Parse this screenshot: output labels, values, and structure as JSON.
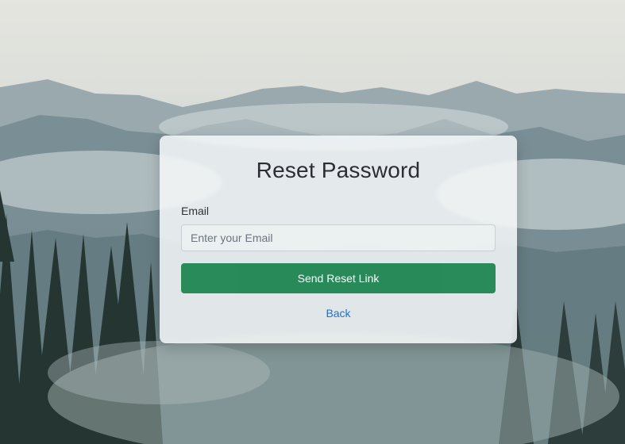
{
  "form": {
    "title": "Reset Password",
    "email_label": "Email",
    "email_placeholder": "Enter your Email",
    "email_value": "",
    "submit_label": "Send Reset Link",
    "back_label": "Back"
  },
  "colors": {
    "primary_button": "#1f8552",
    "link": "#1e6fd1",
    "card_background": "#f6f8f9"
  },
  "background": {
    "scene": "misty-forest-mountains"
  }
}
